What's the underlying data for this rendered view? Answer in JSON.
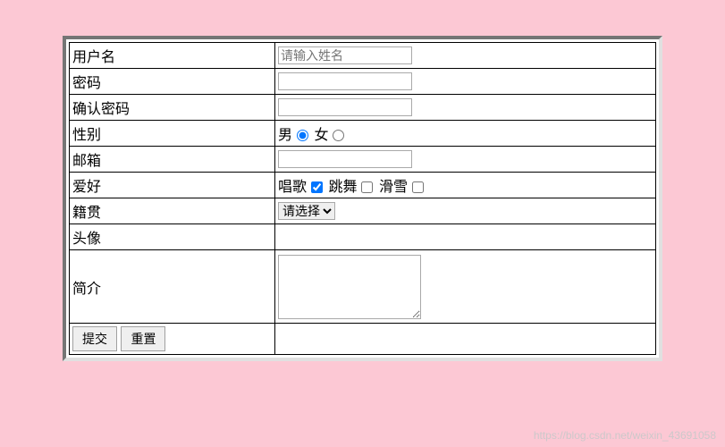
{
  "fields": {
    "username": {
      "label": "用户名",
      "placeholder": "请输入姓名"
    },
    "password": {
      "label": "密码"
    },
    "confirm": {
      "label": "确认密码"
    },
    "gender": {
      "label": "性别",
      "male": "男",
      "female": "女"
    },
    "email": {
      "label": "邮箱"
    },
    "hobby": {
      "label": "爱好",
      "sing": "唱歌",
      "dance": "跳舞",
      "ski": "滑雪"
    },
    "origin": {
      "label": "籍贯",
      "selected": "请选择"
    },
    "avatar": {
      "label": "头像"
    },
    "bio": {
      "label": "简介"
    }
  },
  "buttons": {
    "submit": "提交",
    "reset": "重置"
  },
  "watermark": "https://blog.csdn.net/weixin_43691058"
}
